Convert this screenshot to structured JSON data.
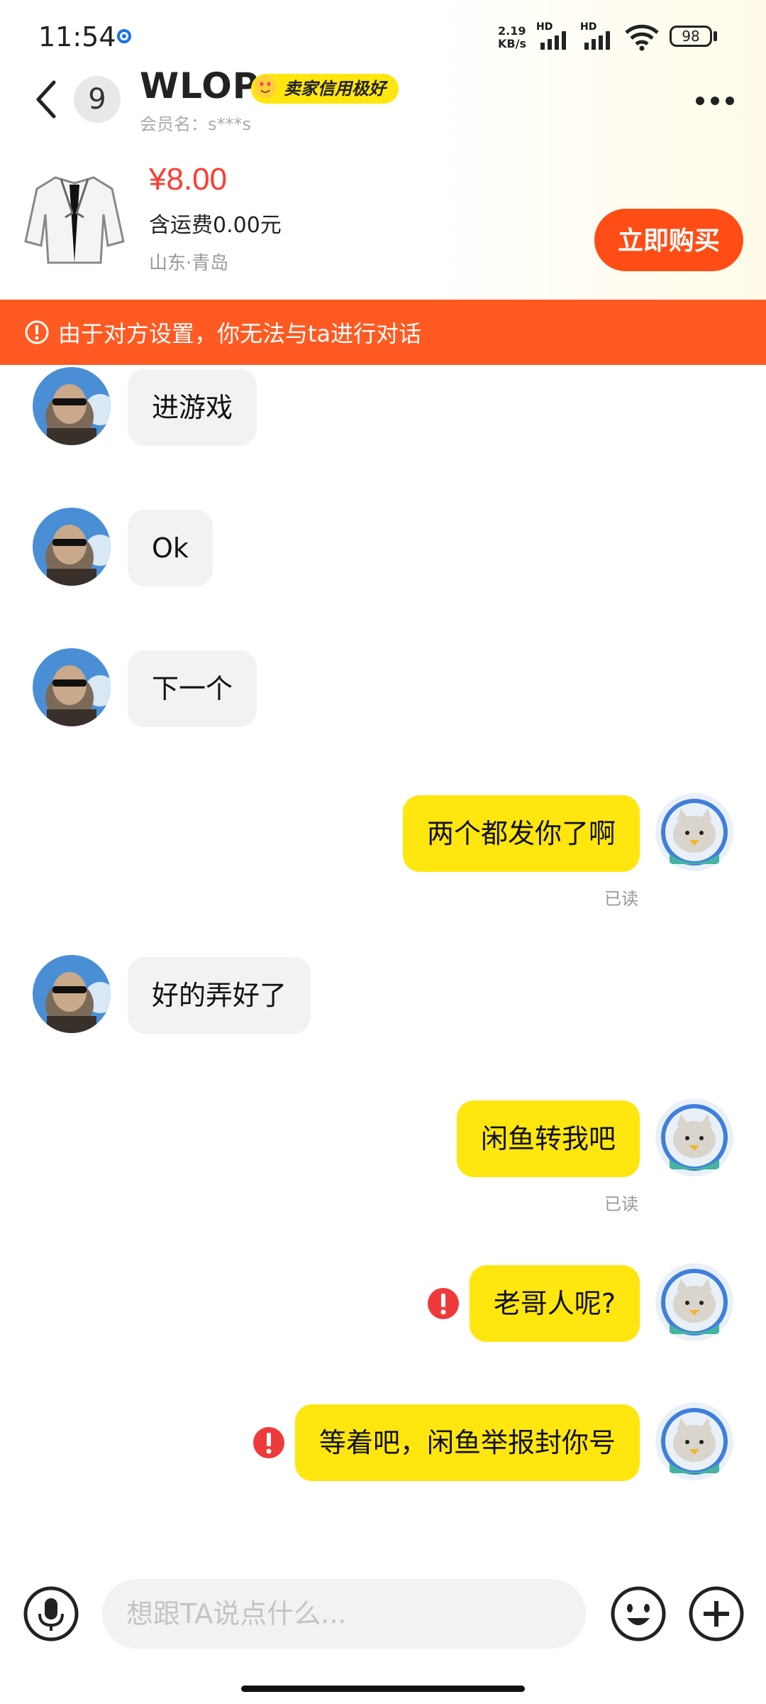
{
  "status_bar": {
    "time": "11:54",
    "network_speed_value": "2.19",
    "network_speed_unit": "KB/s",
    "signal_label_1": "HD",
    "signal_label_2": "HD",
    "battery": "98"
  },
  "header": {
    "unread_count": "9",
    "title": "WLOP",
    "credit_badge": "卖家信用极好",
    "member_name": "会员名：s***s"
  },
  "product": {
    "price": "¥8.00",
    "shipping": "含运费0.00元",
    "location": "山东·青岛",
    "buy_label": "立即购买"
  },
  "warning": {
    "text": "由于对方设置，你无法与ta进行对话"
  },
  "messages": [
    {
      "side": "left",
      "text": "进游戏"
    },
    {
      "side": "left",
      "text": "Ok"
    },
    {
      "side": "left",
      "text": "下一个"
    },
    {
      "side": "right",
      "text": "两个都发你了啊",
      "status": "已读"
    },
    {
      "side": "left",
      "text": "好的弄好了"
    },
    {
      "side": "right",
      "text": "闲鱼转我吧",
      "status": "已读"
    },
    {
      "side": "right",
      "text": "老哥人呢?",
      "failed": true
    },
    {
      "side": "right",
      "text": "等着吧，闲鱼举报封你号",
      "failed": true
    }
  ],
  "input": {
    "placeholder": "想跟TA说点什么..."
  },
  "colors": {
    "accent_yellow": "#ffe60f",
    "warning_orange": "#ff5a22",
    "price_red": "#ff3b30",
    "buy_orange": "#ff4d15",
    "error_red": "#ee3a3a"
  },
  "icons": [
    "back-icon",
    "more-icon",
    "warning-icon",
    "error-icon",
    "mic-icon",
    "emoji-icon",
    "plus-icon"
  ]
}
